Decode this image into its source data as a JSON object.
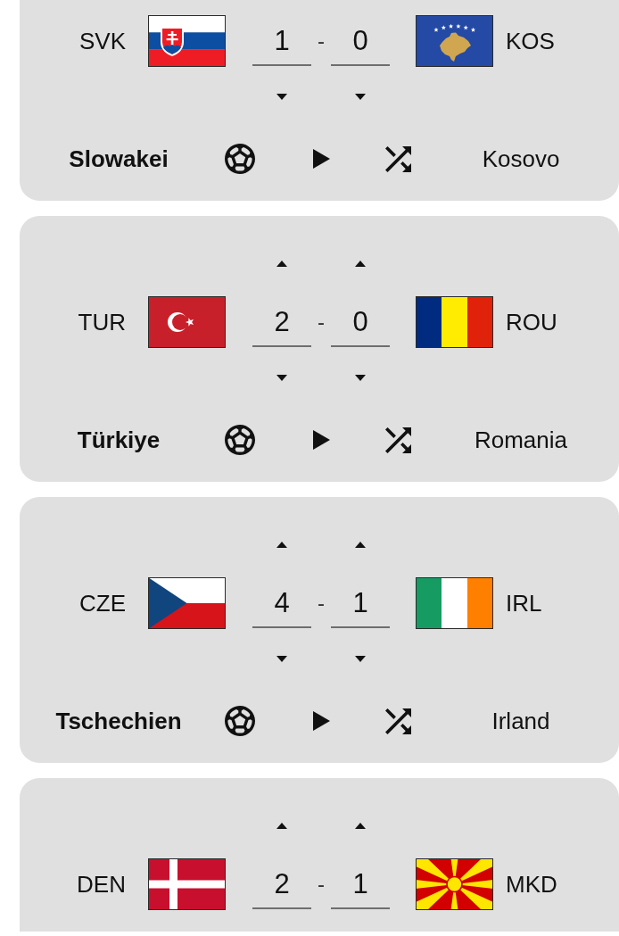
{
  "matches": [
    {
      "top_cut": true,
      "bottom_cut": false,
      "home": {
        "code": "SVK",
        "flag": {
          "kind": "slovakia"
        },
        "name": "Slowakei",
        "winner": true
      },
      "score": {
        "home": "1",
        "separator": "-",
        "away": "0"
      },
      "away": {
        "code": "KOS",
        "flag": {
          "kind": "kosovo"
        },
        "name": "Kosovo",
        "winner": false
      }
    },
    {
      "top_cut": false,
      "bottom_cut": false,
      "home": {
        "code": "TUR",
        "flag": {
          "kind": "turkey"
        },
        "name": "Türkiye",
        "winner": true
      },
      "score": {
        "home": "2",
        "separator": "-",
        "away": "0"
      },
      "away": {
        "code": "ROU",
        "flag": {
          "kind": "romania"
        },
        "name": "Romania",
        "winner": false
      }
    },
    {
      "top_cut": false,
      "bottom_cut": false,
      "home": {
        "code": "CZE",
        "flag": {
          "kind": "czechia"
        },
        "name": "Tschechien",
        "winner": true
      },
      "score": {
        "home": "4",
        "separator": "-",
        "away": "1"
      },
      "away": {
        "code": "IRL",
        "flag": {
          "kind": "ireland"
        },
        "name": "Irland",
        "winner": false
      }
    },
    {
      "top_cut": false,
      "bottom_cut": true,
      "home": {
        "code": "DEN",
        "flag": {
          "kind": "denmark"
        }
      },
      "score": {
        "home": "2",
        "separator": "-",
        "away": "1"
      },
      "away": {
        "code": "MKD",
        "flag": {
          "kind": "north_macedonia"
        }
      }
    }
  ]
}
